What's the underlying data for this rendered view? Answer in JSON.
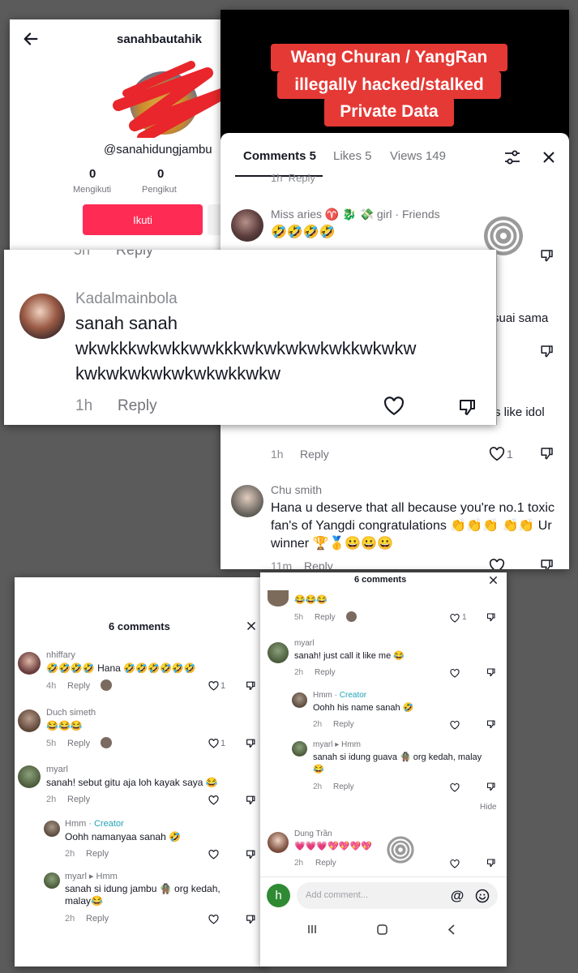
{
  "profile": {
    "username": "sanahbautahik",
    "handle": "@sanahidungjambu",
    "stats": [
      {
        "value": "0",
        "label": "Mengikuti"
      },
      {
        "value": "0",
        "label": "Pengikut"
      }
    ],
    "follow_label": "Ikuti"
  },
  "banner": {
    "lines": [
      "Wang Churan / YangRan",
      "illegally hacked/stalked",
      "Private Data"
    ]
  },
  "sheet": {
    "tabs": [
      {
        "label": "Comments 5"
      },
      {
        "label": "Likes 5"
      },
      {
        "label": "Views 149"
      }
    ],
    "partial_top": "1h  Reply",
    "comment1": {
      "user": "Miss aries ♈ 🐉 💸 girl · Friends",
      "text": "🤣🤣🤣🤣"
    },
    "partial_a": "suai sama",
    "partial_b": "s like idol",
    "row_meta": {
      "time": "1h",
      "reply": "Reply",
      "likes": "1"
    },
    "comment2": {
      "user": "Chu smith",
      "text": "Hana u deserve that all because you're no.1 toxic fan's of Yangdi congratulations 👏👏👏 👏👏 Ur winner 🏆🥇😀😀😀",
      "time": "11m",
      "reply": "Reply"
    }
  },
  "overlay": {
    "user": "Kadalmainbola",
    "text": "sanah sanah wkwkkkwkwkkwwkkkwkwkwkwkwkkwkwkw kwkwkwkwkwkwkwkkwkw",
    "line1": "sanah sanah",
    "line2": "wkwkkkwkwkkwwkkkwkwkwkwkwkkwkwkw",
    "line3": "kwkwkwkwkwkwkwkkwkw",
    "time": "1h",
    "reply": "Reply",
    "cut_time": "5h",
    "cut_reply": "Reply"
  },
  "left_panel": {
    "title": "6 comments",
    "comments": [
      {
        "user": "nhiffary",
        "text": "🤣🤣🤣🤣 Hana 🤣🤣🤣🤣🤣🤣",
        "time": "4h",
        "reply": "Reply",
        "likes": "1"
      },
      {
        "user": "Duch simeth",
        "text": "😂😂😂",
        "time": "5h",
        "reply": "Reply",
        "likes": "1"
      },
      {
        "user": "myarl",
        "text": "sanah! sebut gitu aja loh kayak saya 😂",
        "time": "2h",
        "reply": "Reply"
      },
      {
        "user": "Hmm",
        "creator": "· Creator",
        "text": "Oohh namanyaa sanah 🤣",
        "time": "2h",
        "reply": "Reply"
      },
      {
        "user": "myarl ▸ Hmm",
        "text": "sanah si idung jambu 🧌 org kedah, malay😂",
        "time": "2h",
        "reply": "Reply"
      }
    ]
  },
  "right_panel": {
    "title": "6 comments",
    "comments": [
      {
        "text": "😂😂😂",
        "time": "5h",
        "reply": "Reply",
        "likes": "1"
      },
      {
        "user": "myarl",
        "text": "sanah! just call it like me 😂",
        "time": "2h",
        "reply": "Reply"
      },
      {
        "user": "Hmm",
        "creator": "· Creator",
        "text": "Oohh his name sanah 🤣",
        "time": "2h",
        "reply": "Reply"
      },
      {
        "user": "myarl ▸ Hmm",
        "text": "sanah si idung guava 🧌 org kedah, malay😂",
        "time": "2h",
        "reply": "Reply"
      },
      {
        "user": "Dung Trần",
        "text": "💗💗💗💖💖💖💖",
        "time": "2h",
        "reply": "Reply"
      }
    ],
    "hide": "Hide",
    "input": {
      "avatar_letter": "h",
      "placeholder": "Add comment..."
    }
  },
  "colors": {
    "follow": "#fe2c55",
    "banner_bg": "#000000",
    "banner_box": "#e53935",
    "creator": "#20a3b5",
    "page_bg": "#5b5b5b"
  }
}
